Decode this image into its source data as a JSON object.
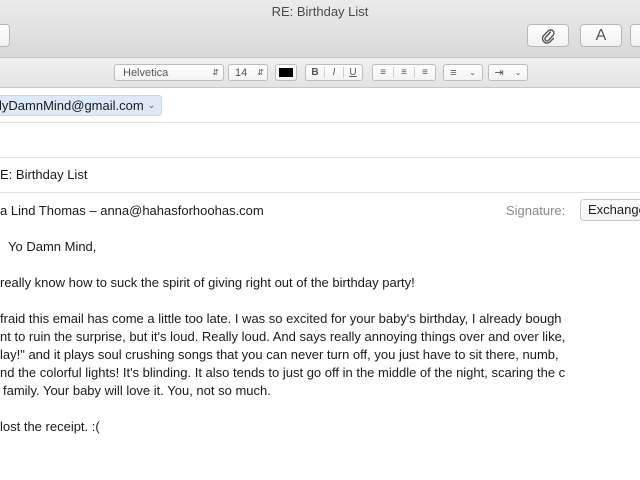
{
  "window": {
    "title": "RE: Birthday List"
  },
  "toolbar": {
    "attach_icon": "paperclip-icon",
    "font_label": "A"
  },
  "format_bar": {
    "font_family": "Helvetica",
    "font_size": "14",
    "text_color": "#000000",
    "bold": "B",
    "italic": "I",
    "underline": "U"
  },
  "header": {
    "from": "lyDamnMind@gmail.com",
    "subject": "E: Birthday List",
    "recipient_line": "a Lind Thomas – anna@hahasforhoohas.com",
    "signature_label": "Signature:",
    "signature_value": "Exchange"
  },
  "body": {
    "greeting": "Yo Damn Mind,",
    "line1": " really know how to suck the spirit of giving right out of the birthday party!",
    "para2": [
      "fraid this email has come a little too late. I was so excited for your baby's birthday, I already bough",
      "nt to ruin the surprise, but it's loud. Really loud. And says really annoying things over and over like,",
      "lay!\" and it plays soul crushing songs that you can never turn off, you just have to sit there, numb,",
      "nd the colorful lights! It's blinding. It also tends to just go off in the middle of the night, scaring the c",
      "family. Your baby will love it. You, not so much."
    ],
    "closing": " lost the receipt. :("
  }
}
